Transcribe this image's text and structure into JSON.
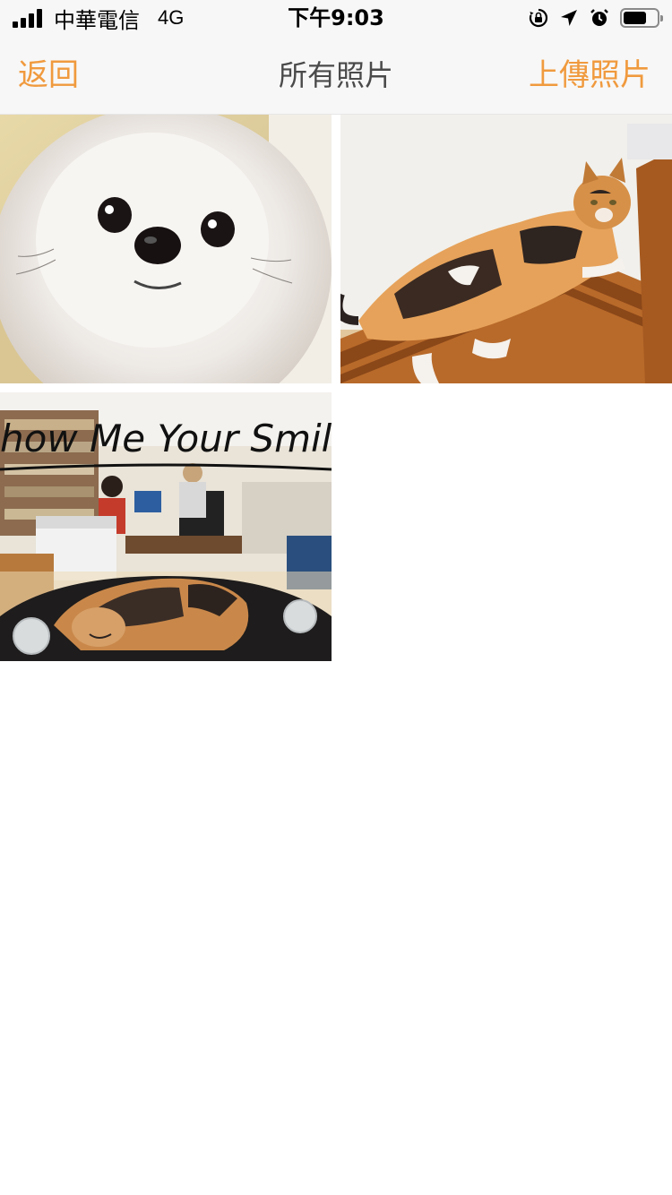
{
  "status_bar": {
    "carrier": "中華電信",
    "network": "4G",
    "time": "下午9:03",
    "battery_level": 0.7,
    "icons": [
      "signal-icon",
      "orientation-lock-icon",
      "location-arrow-icon",
      "alarm-icon",
      "battery-icon"
    ]
  },
  "nav": {
    "back_label": "返回",
    "title": "所有照片",
    "upload_label": "上傳照片",
    "accent_color": "#f09a3e"
  },
  "photos": [
    {
      "subject": "white-pomeranian-dog"
    },
    {
      "subject": "calico-cat-on-wooden-bench"
    },
    {
      "subject": "office-scene-with-cat"
    }
  ],
  "photo3_overlay_text": "how Me Your Smil"
}
